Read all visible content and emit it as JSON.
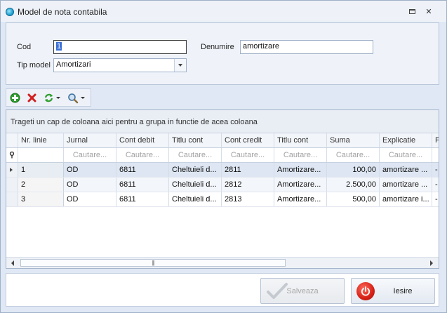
{
  "window": {
    "title": "Model de nota contabila"
  },
  "form": {
    "cod_label": "Cod",
    "cod_value": "1",
    "denumire_label": "Denumire",
    "denumire_value": "amortizare",
    "tip_model_label": "Tip model",
    "tip_model_value": "Amortizari"
  },
  "toolbar": {
    "icons": [
      "add-icon",
      "delete-icon",
      "refresh-icon",
      "search-icon"
    ]
  },
  "grid": {
    "group_panel_text": "Trageti un cap de coloana aici pentru a grupa in functie de acea coloana",
    "columns": [
      "Nr. linie",
      "Jurnal",
      "Cont debit",
      "Titlu cont",
      "Cont credit",
      "Titlu cont",
      "Suma",
      "Explicatie",
      "P"
    ],
    "filter_placeholder": "Cautare...",
    "rows": [
      {
        "nr_linie": "1",
        "jurnal": "OD",
        "cont_debit": "6811",
        "titlu_cont_debit": "Cheltuieli d...",
        "cont_credit": "2811",
        "titlu_cont_credit": "Amortizare...",
        "suma": "100,00",
        "explicatie": "amortizare ...",
        "p": "-"
      },
      {
        "nr_linie": "2",
        "jurnal": "OD",
        "cont_debit": "6811",
        "titlu_cont_debit": "Cheltuieli d...",
        "cont_credit": "2812",
        "titlu_cont_credit": "Amortizare...",
        "suma": "2.500,00",
        "explicatie": "amortizare ...",
        "p": "-"
      },
      {
        "nr_linie": "3",
        "jurnal": "OD",
        "cont_debit": "6811",
        "titlu_cont_debit": "Cheltuieli d...",
        "cont_credit": "2813",
        "titlu_cont_credit": "Amortizare...",
        "suma": "500,00",
        "explicatie": "amortizare i...",
        "p": "-"
      }
    ]
  },
  "buttons": {
    "save_label": "Salveaza",
    "exit_label": "Iesire"
  },
  "colors": {
    "accent": "#3b6fd6",
    "exit_icon": "#d52016",
    "add_icon": "#2e9e2e",
    "delete_icon": "#d02020"
  }
}
